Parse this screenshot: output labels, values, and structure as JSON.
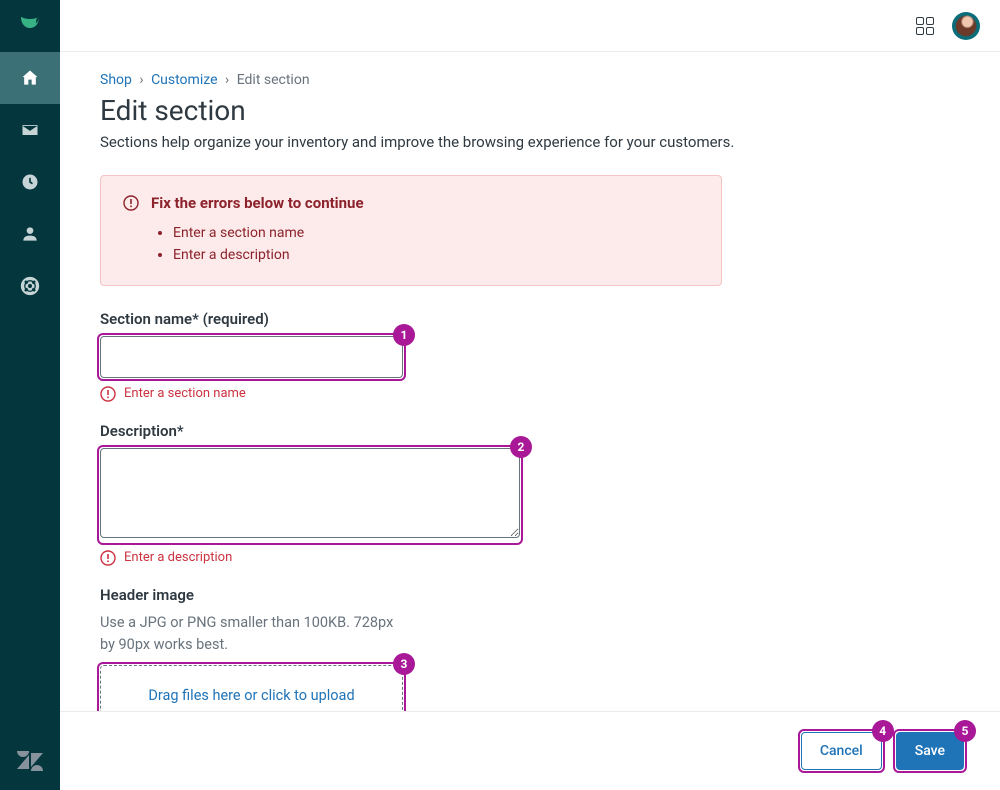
{
  "breadcrumb": {
    "shop": "Shop",
    "customize": "Customize",
    "current": "Edit section"
  },
  "page": {
    "title": "Edit section",
    "description": "Sections help organize your inventory and improve the browsing experience for your customers."
  },
  "alert": {
    "title": "Fix the errors below to continue",
    "items": [
      "Enter a section name",
      "Enter a description"
    ]
  },
  "form": {
    "section_name": {
      "label": "Section name* (required)",
      "value": "",
      "error": "Enter a section name"
    },
    "description": {
      "label": "Description*",
      "value": "",
      "error": "Enter a description"
    },
    "header_image": {
      "label": "Header image",
      "hint": "Use a JPG or PNG smaller than 100KB. 728px by 90px works best.",
      "dropzone": "Drag files here or click to upload"
    }
  },
  "footer": {
    "cancel": "Cancel",
    "save": "Save"
  },
  "annotations": {
    "n1": "1",
    "n2": "2",
    "n3": "3",
    "n4": "4",
    "n5": "5"
  }
}
